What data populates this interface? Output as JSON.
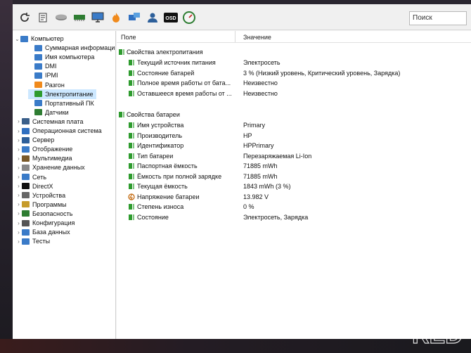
{
  "search": {
    "label": "Поиск"
  },
  "toolbar": {
    "buttons": [
      {
        "icon": "refresh-icon"
      },
      {
        "icon": "report-icon"
      },
      {
        "icon": "disk-icon"
      },
      {
        "icon": "memory-icon"
      },
      {
        "icon": "monitor-icon"
      },
      {
        "icon": "flame-icon"
      },
      {
        "icon": "network-icon"
      },
      {
        "icon": "user-icon"
      },
      {
        "icon": "osd-icon",
        "text": "OSD"
      },
      {
        "icon": "gauge-icon"
      }
    ]
  },
  "tree": {
    "items": [
      {
        "label": "Компьютер",
        "expanded": true
      },
      {
        "label": "Суммарная информаци"
      },
      {
        "label": "Имя компьютера"
      },
      {
        "label": "DMI"
      },
      {
        "label": "IPMI"
      },
      {
        "label": "Разгон"
      },
      {
        "label": "Электропитание",
        "selected": true
      },
      {
        "label": "Портативный ПК"
      },
      {
        "label": "Датчики"
      },
      {
        "label": "Системная плата"
      },
      {
        "label": "Операционная система"
      },
      {
        "label": "Сервер"
      },
      {
        "label": "Отображение"
      },
      {
        "label": "Мультимедиа"
      },
      {
        "label": "Хранение данных"
      },
      {
        "label": "Сеть"
      },
      {
        "label": "DirectX"
      },
      {
        "label": "Устройства"
      },
      {
        "label": "Программы"
      },
      {
        "label": "Безопасность"
      },
      {
        "label": "Конфигурация"
      },
      {
        "label": "База данных"
      },
      {
        "label": "Тесты"
      }
    ]
  },
  "columns": {
    "field": "Поле",
    "value": "Значение"
  },
  "sections": [
    {
      "title": "Свойства электропитания",
      "rows": [
        {
          "field": "Текущий источник питания",
          "value": "Электросеть"
        },
        {
          "field": "Состояние батарей",
          "value": "3 % (Низкий уровень, Критический уровень, Зарядка)"
        },
        {
          "field": "Полное время работы от бата...",
          "value": "Неизвестно"
        },
        {
          "field": "Оставшееся время работы от ...",
          "value": "Неизвестно"
        }
      ]
    },
    {
      "title": "Свойства батареи",
      "rows": [
        {
          "field": "Имя устройства",
          "value": "Primary"
        },
        {
          "field": "Производитель",
          "value": "HP"
        },
        {
          "field": "Идентификатор",
          "value": "HPPrimary"
        },
        {
          "field": "Тип батареи",
          "value": "Перезаряжаемая Li-Ion"
        },
        {
          "field": "Паспортная ёмкость",
          "value": "71885 mWh"
        },
        {
          "field": "Ёмкость при полной зарядке",
          "value": "71885 mWh"
        },
        {
          "field": "Текущая ёмкость",
          "value": "1843 mWh  (3 %)"
        },
        {
          "field": "Напряжение батареи",
          "value": "13.982 V"
        },
        {
          "field": "Степень износа",
          "value": "0 %"
        },
        {
          "field": "Состояние",
          "value": "Электросеть, Зарядка"
        }
      ]
    }
  ],
  "watermark": {
    "line1": "DNR",
    "line2": "RED"
  },
  "colors": {
    "accent": "#cde8ff",
    "battery": "#2e9b2e"
  }
}
